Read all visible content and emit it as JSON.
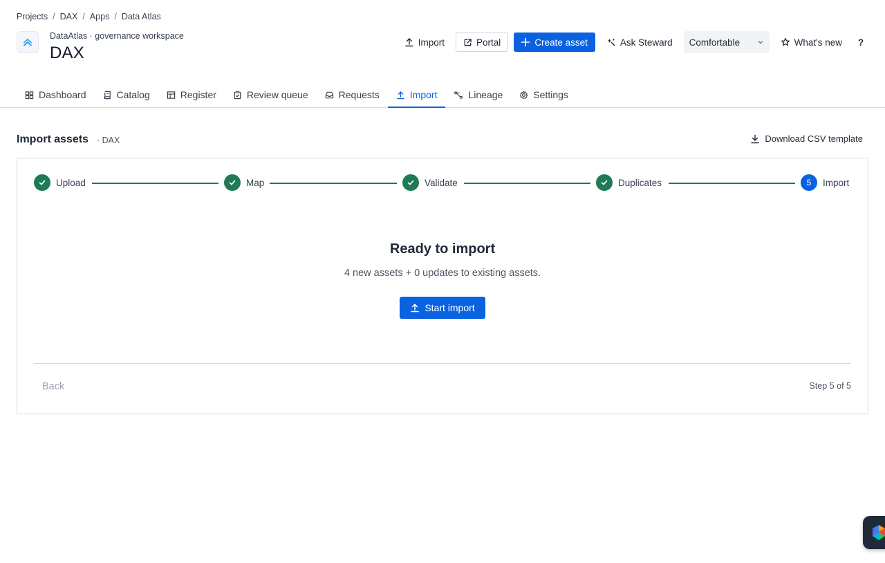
{
  "breadcrumb": {
    "items": [
      "Projects",
      "DAX",
      "Apps",
      "Data Atlas"
    ],
    "separator": "/"
  },
  "header": {
    "subtitle": "DataAtlas · governance workspace",
    "title": "DAX",
    "logo_icon": "chevrons-up-icon"
  },
  "actions": {
    "import_label": "Import",
    "portal_label": "Portal",
    "create_label": "Create asset",
    "ask_label": "Ask Steward",
    "density_value": "Comfortable",
    "whats_new_label": "What's new",
    "help_label": "?"
  },
  "tabs": [
    {
      "label": "Dashboard",
      "icon": "dashboard-icon",
      "active": false
    },
    {
      "label": "Catalog",
      "icon": "book-icon",
      "active": false
    },
    {
      "label": "Register",
      "icon": "table-icon",
      "active": false
    },
    {
      "label": "Review queue",
      "icon": "clipboard-check-icon",
      "active": false
    },
    {
      "label": "Requests",
      "icon": "inbox-icon",
      "active": false
    },
    {
      "label": "Import",
      "icon": "upload-icon",
      "active": true
    },
    {
      "label": "Lineage",
      "icon": "lineage-icon",
      "active": false
    },
    {
      "label": "Settings",
      "icon": "gear-icon",
      "active": false
    }
  ],
  "section": {
    "title": "Import assets",
    "subtitle": "· DAX",
    "download_label": "Download CSV template"
  },
  "wizard": {
    "steps": [
      {
        "label": "Upload",
        "status": "done"
      },
      {
        "label": "Map",
        "status": "done"
      },
      {
        "label": "Validate",
        "status": "done"
      },
      {
        "label": "Duplicates",
        "status": "done"
      },
      {
        "label": "Import",
        "status": "current",
        "number": "5"
      }
    ],
    "ready_title": "Ready to import",
    "ready_desc": "4 new assets + 0 updates to existing assets.",
    "start_label": "Start import",
    "back_label": "Back",
    "step_count": "Step 5 of 5"
  },
  "colors": {
    "primary": "#0b62e0",
    "success": "#1f7a55",
    "border": "#d7dbe0"
  }
}
